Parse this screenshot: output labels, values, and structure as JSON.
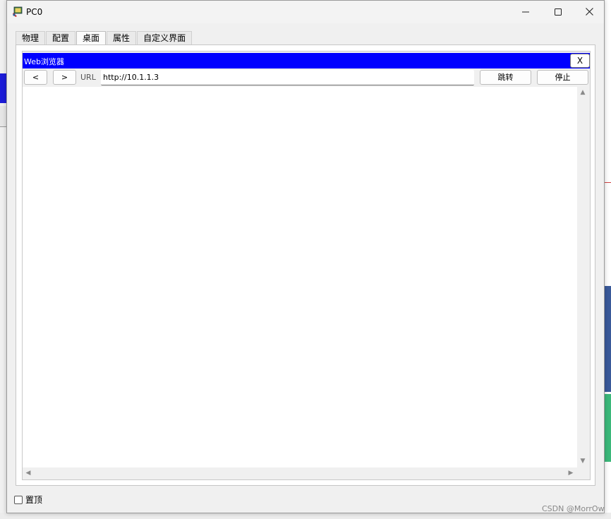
{
  "window": {
    "title": "PC0",
    "controls": [
      "minimize-icon",
      "maximize-icon",
      "close-icon"
    ]
  },
  "tabs": [
    {
      "label": "物理",
      "active": false
    },
    {
      "label": "配置",
      "active": false
    },
    {
      "label": "桌面",
      "active": true
    },
    {
      "label": "属性",
      "active": false
    },
    {
      "label": "自定义界面",
      "active": false
    }
  ],
  "browser": {
    "title": "Web浏览器",
    "close_label": "X",
    "back_label": "<",
    "forward_label": ">",
    "url_label": "URL",
    "url_value": "http://10.1.1.3",
    "go_label": "跳转",
    "stop_label": "停止"
  },
  "footer": {
    "topmost_label": "置顶",
    "topmost_checked": false
  },
  "watermark": "CSDN @MorrOw",
  "colors": {
    "browser_header": "#0000ff",
    "window_bg": "#f0f0f0"
  }
}
